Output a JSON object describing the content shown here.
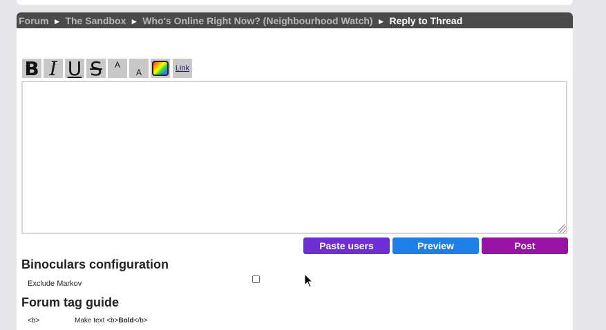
{
  "breadcrumb": {
    "items": [
      "Forum",
      "The Sandbox",
      "Who's Online Right Now? (Neighbourhood Watch)"
    ],
    "separator": "►",
    "current": "Reply to Thread"
  },
  "toolbar": {
    "bold": "B",
    "italic": "I",
    "underline": "U",
    "strike": "S",
    "bigger": "A",
    "smaller": "A",
    "color_icon": "color-picker-icon",
    "link": "Link"
  },
  "editor": {
    "value": ""
  },
  "actions": {
    "paste_users": "Paste users",
    "preview": "Preview",
    "post": "Post",
    "colors": {
      "paste_users": "#6d2fd3",
      "preview": "#1e7fe8",
      "post": "#9a12a6"
    }
  },
  "binoculars": {
    "title": "Binoculars configuration",
    "exclude_markov_label": "Exclude Markov",
    "exclude_markov_checked": false
  },
  "tag_guide": {
    "title": "Forum tag guide",
    "rows": [
      {
        "tag": "<b>",
        "desc_prefix": "Make text <b>",
        "desc_bold": "Bold",
        "desc_suffix": "</b>"
      }
    ]
  }
}
